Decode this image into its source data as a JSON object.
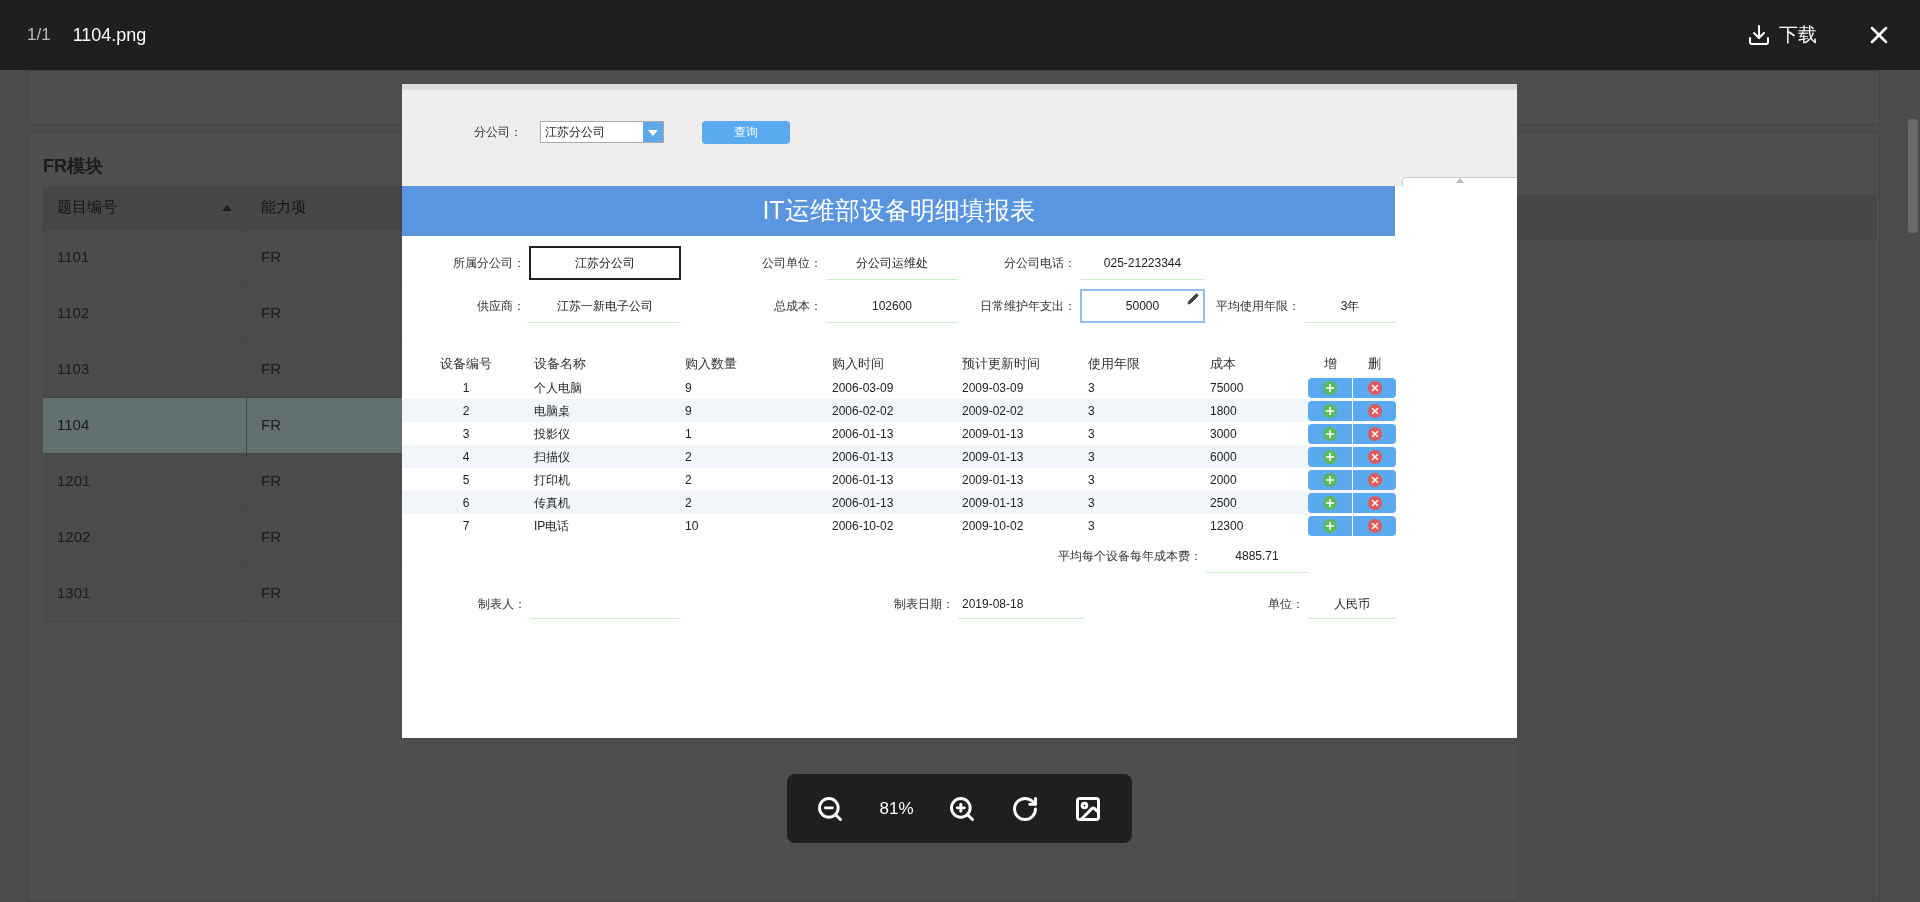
{
  "viewer": {
    "counter": "1/1",
    "filename": "1104.png",
    "download": "下载",
    "zoom": "81%"
  },
  "background": {
    "section_title": "FR模块",
    "columns": [
      {
        "label": "题目编号",
        "sorted": true
      },
      {
        "label": "能力项",
        "sorted": false
      }
    ],
    "rows": [
      {
        "id": "1101",
        "ability": "FR",
        "selected": false
      },
      {
        "id": "1102",
        "ability": "FR",
        "selected": false
      },
      {
        "id": "1103",
        "ability": "FR",
        "selected": false
      },
      {
        "id": "1104",
        "ability": "FR",
        "selected": true
      },
      {
        "id": "1201",
        "ability": "FR",
        "selected": false
      },
      {
        "id": "1202",
        "ability": "FR",
        "selected": false
      },
      {
        "id": "1301",
        "ability": "FR",
        "selected": false
      }
    ]
  },
  "report": {
    "filter_label": "分公司：",
    "filter_value": "江苏分公司",
    "query_button": "查询",
    "title": "IT运维部设备明细填报表",
    "field_rows": [
      [
        {
          "label": "所属分公司：",
          "value": "江苏分公司",
          "kind": "focused"
        },
        {
          "label": "公司单位：",
          "value": "分公司运维处",
          "kind": "plain"
        },
        {
          "label": "分公司电话：",
          "value": "025-21223344",
          "kind": "plain"
        }
      ],
      [
        {
          "label": "供应商：",
          "value": "江苏一新电子公司",
          "kind": "plain"
        },
        {
          "label": "总成本：",
          "value": "102600",
          "kind": "plain"
        },
        {
          "label": "日常维护年支出：",
          "value": "50000",
          "kind": "editing"
        },
        {
          "label": "平均使用年限：",
          "value": "3年",
          "kind": "plain"
        }
      ]
    ],
    "columns": [
      "设备编号",
      "设备名称",
      "购入数量",
      "购入时间",
      "预计更新时间",
      "使用年限",
      "成本",
      "增",
      "删"
    ],
    "rows": [
      [
        "1",
        "个人电脑",
        "9",
        "2006-03-09",
        "2009-03-09",
        "3",
        "75000"
      ],
      [
        "2",
        "电脑桌",
        "9",
        "2006-02-02",
        "2009-02-02",
        "3",
        "1800"
      ],
      [
        "3",
        "投影仪",
        "1",
        "2006-01-13",
        "2009-01-13",
        "3",
        "3000"
      ],
      [
        "4",
        "扫描仪",
        "2",
        "2006-01-13",
        "2009-01-13",
        "3",
        "6000"
      ],
      [
        "5",
        "打印机",
        "2",
        "2006-01-13",
        "2009-01-13",
        "3",
        "2000"
      ],
      [
        "6",
        "传真机",
        "2",
        "2006-01-13",
        "2009-01-13",
        "3",
        "2500"
      ],
      [
        "7",
        "IP电话",
        "10",
        "2006-10-02",
        "2009-10-02",
        "3",
        "12300"
      ]
    ],
    "average_label": "平均每个设备每年成本费：",
    "average_value": "4885.71",
    "footer": [
      {
        "label": "制表人："
      },
      {
        "label": "制表日期：",
        "value": "2019-08-18"
      },
      {
        "label": "单位：",
        "value": "人民币"
      }
    ]
  }
}
